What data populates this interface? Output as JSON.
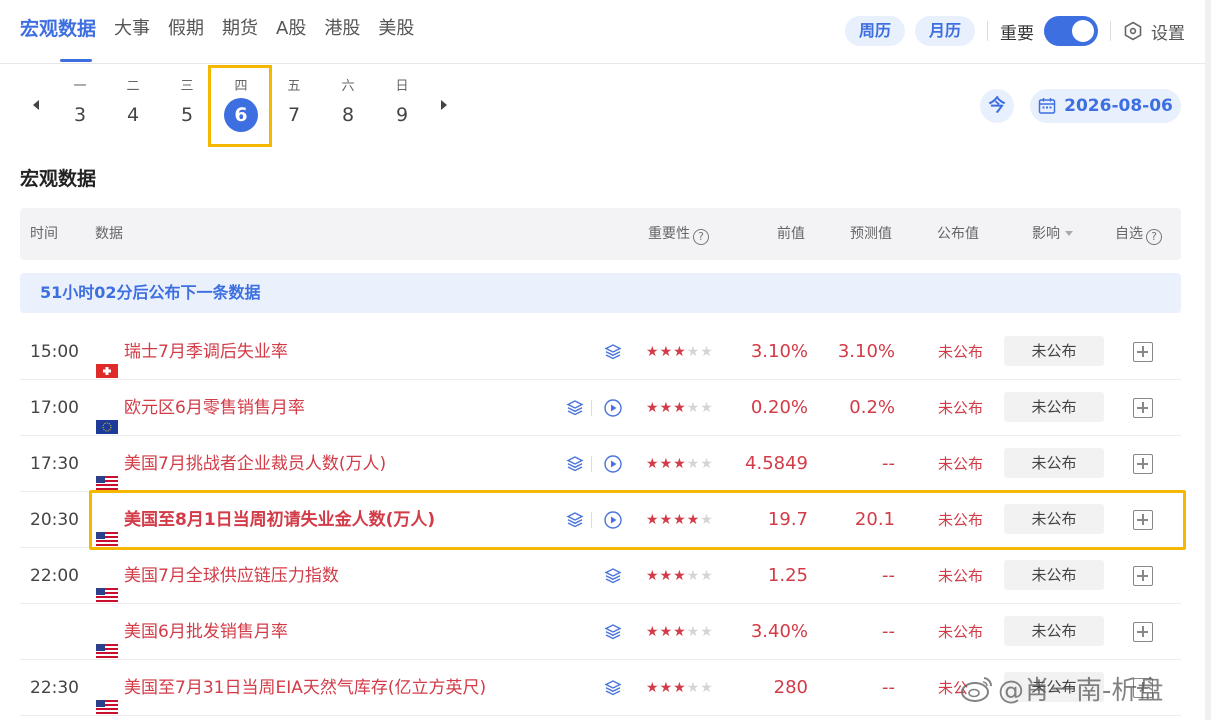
{
  "nav": {
    "tabs": [
      "宏观数据",
      "大事",
      "假期",
      "期货",
      "A股",
      "港股",
      "美股"
    ],
    "active_index": 0,
    "week_btn": "周历",
    "month_btn": "月历",
    "toggle_label": "重要",
    "toggle_on": true,
    "settings_label": "设置"
  },
  "date_strip": {
    "days": [
      {
        "weekday": "一",
        "num": "3"
      },
      {
        "weekday": "二",
        "num": "4"
      },
      {
        "weekday": "三",
        "num": "5"
      },
      {
        "weekday": "四",
        "num": "6",
        "selected": true
      },
      {
        "weekday": "五",
        "num": "7"
      },
      {
        "weekday": "六",
        "num": "8"
      },
      {
        "weekday": "日",
        "num": "9"
      }
    ],
    "today_label": "今",
    "current_date": "2026-08-06"
  },
  "section_title": "宏观数据",
  "table_header": {
    "time": "时间",
    "data": "数据",
    "importance": "重要性",
    "prev": "前值",
    "forecast": "预测值",
    "published": "公布值",
    "impact": "影响",
    "watch": "自选"
  },
  "notice": "51小时02分后公布下一条数据",
  "rows": [
    {
      "time": "15:00",
      "flag": "ch",
      "title": "瑞士7月季调后失业率",
      "stars": 3,
      "prev": "3.10%",
      "forecast": "3.10%",
      "published": "未公布",
      "impact": "未公布",
      "has_video": false
    },
    {
      "time": "17:00",
      "flag": "eu",
      "title": "欧元区6月零售销售月率",
      "stars": 3,
      "prev": "0.20%",
      "forecast": "0.2%",
      "published": "未公布",
      "impact": "未公布",
      "has_video": true
    },
    {
      "time": "17:30",
      "flag": "us",
      "title": "美国7月挑战者企业裁员人数(万人)",
      "stars": 3,
      "prev": "4.5849",
      "forecast": "--",
      "published": "未公布",
      "impact": "未公布",
      "has_video": true
    },
    {
      "time": "20:30",
      "flag": "us",
      "title": "美国至8月1日当周初请失业金人数(万人)",
      "stars": 4,
      "prev": "19.7",
      "forecast": "20.1",
      "published": "未公布",
      "impact": "未公布",
      "has_video": true,
      "bold": true
    },
    {
      "time": "22:00",
      "flag": "us",
      "title": "美国7月全球供应链压力指数",
      "stars": 3,
      "prev": "1.25",
      "forecast": "--",
      "published": "未公布",
      "impact": "未公布",
      "has_video": false
    },
    {
      "time": "",
      "flag": "us",
      "title": "美国6月批发销售月率",
      "stars": 3,
      "prev": "3.40%",
      "forecast": "--",
      "published": "未公布",
      "impact": "未公布",
      "has_video": false
    },
    {
      "time": "22:30",
      "flag": "us",
      "title": "美国至7月31日当周EIA天然气库存(亿立方英尺)",
      "stars": 3,
      "prev": "280",
      "forecast": "--",
      "published": "未公",
      "impact": "未公布",
      "has_video": false
    }
  ],
  "watermark": "@肖一南-析盘",
  "colors": {
    "accent": "#3d6fe0",
    "red": "#d23b47",
    "highlight": "#f5b800"
  }
}
